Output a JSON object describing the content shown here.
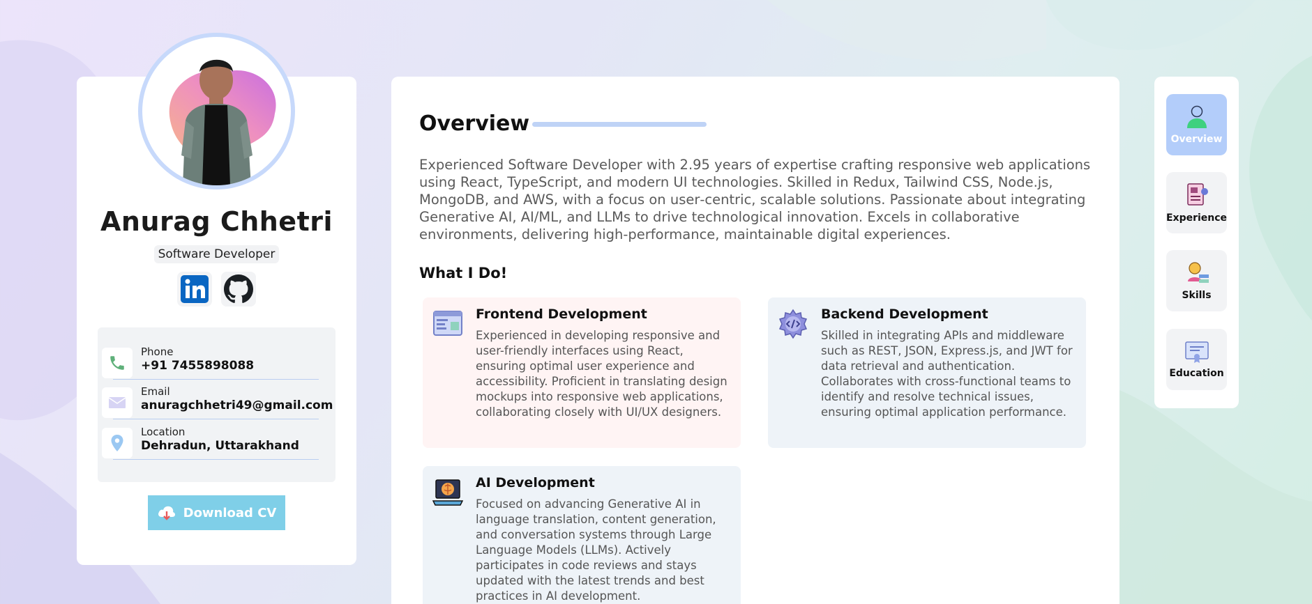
{
  "profile": {
    "name": "Anurag Chhetri",
    "role": "Software Developer",
    "contacts": [
      {
        "label": "Phone",
        "value": "+91 7455898088",
        "icon": "phone-icon"
      },
      {
        "label": "Email",
        "value": "anuragchhetri49@gmail.com",
        "icon": "mail-icon"
      },
      {
        "label": "Location",
        "value": "Dehradun, Uttarakhand",
        "icon": "location-pin-icon"
      }
    ],
    "download_label": "Download CV"
  },
  "overview": {
    "title": "Overview",
    "text": "Experienced Software Developer with 2.95 years of expertise crafting responsive web applications using React, TypeScript, and modern UI technologies. Skilled in Redux, Tailwind CSS, Node.js, MongoDB, and AWS, with a focus on user‑centric, scalable solutions. Passionate about integrating Generative AI, AI/ML, and LLMs to drive technological innovation. Excels in collaborative environments, delivering high-performance, maintainable digital experiences."
  },
  "whatido": {
    "title": "What I Do!",
    "services": [
      {
        "title": "Frontend Development",
        "desc": "Experienced in developing responsive and user-friendly interfaces using React, ensuring optimal user experience and accessibility. Proficient in translating design mockups into responsive web applications, collaborating closely with UI/UX designers.",
        "bg": "#fff4f4"
      },
      {
        "title": "Backend Development",
        "desc": "Skilled in integrating APIs and middleware such as REST, JSON, Express.js, and JWT for data retrieval and authentication. Collaborates with cross-functional teams to identify and resolve technical issues, ensuring optimal application performance.",
        "bg": "#eef3f8"
      },
      {
        "title": "AI Development",
        "desc": "Focused on advancing Generative AI in language translation, content generation, and conversation systems through Large Language Models (LLMs). Actively participates in code reviews and stays updated with the latest trends and best practices in AI development.",
        "bg": "#eef3f8"
      }
    ]
  },
  "nav": {
    "items": [
      {
        "label": "Overview",
        "icon": "person-icon"
      },
      {
        "label": "Experience",
        "icon": "resume-icon"
      },
      {
        "label": "Skills",
        "icon": "skills-icon"
      },
      {
        "label": "Education",
        "icon": "certificate-icon"
      }
    ]
  },
  "colors": {
    "accent": "#b3cdfa",
    "download_button": "#7fcfe8"
  }
}
